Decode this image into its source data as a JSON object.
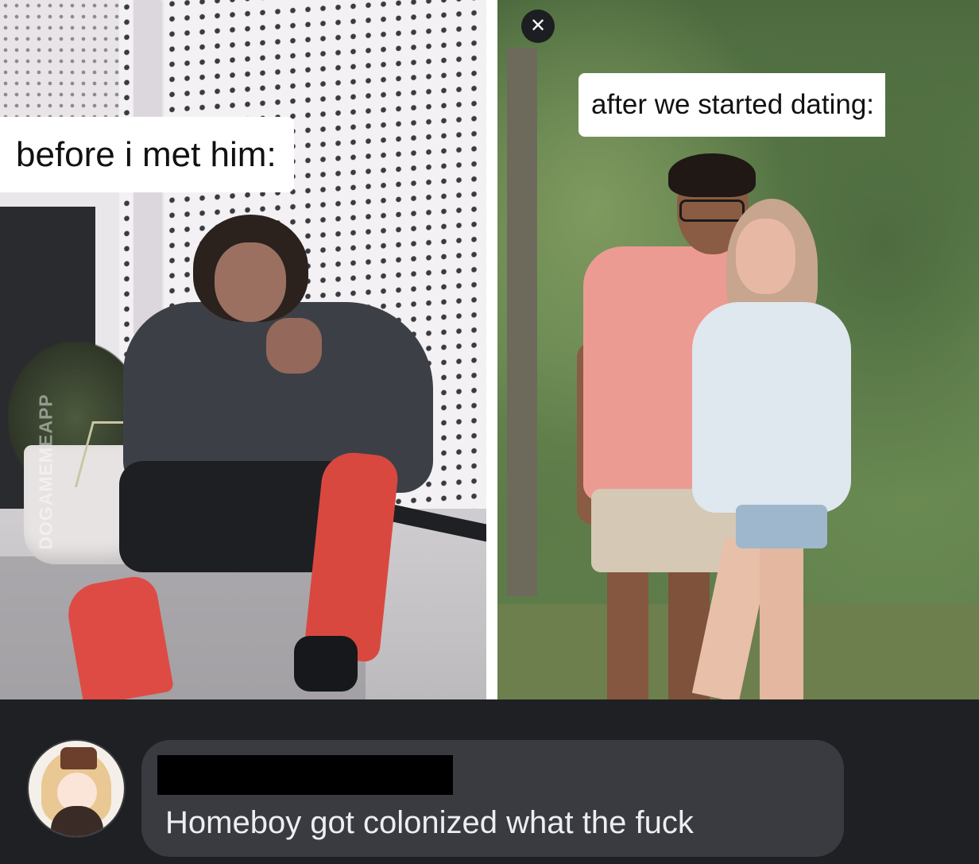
{
  "panels": {
    "left": {
      "caption": "before i met him:",
      "watermark": "DOGAMEMEAPP"
    },
    "right": {
      "caption": "after we started dating:"
    }
  },
  "close_button": {
    "icon": "close-icon",
    "glyph": "✕"
  },
  "comment": {
    "avatar_icon": "user-avatar",
    "username_redacted": true,
    "text": "Homeboy got colonized what the fuck"
  }
}
